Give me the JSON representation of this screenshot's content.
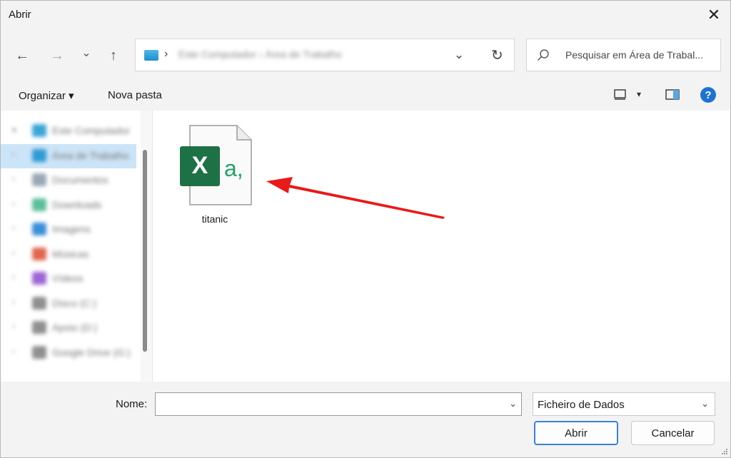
{
  "window": {
    "title": "Abrir",
    "close_glyph": "✕"
  },
  "nav": {
    "back_glyph": "←",
    "forward_glyph": "→",
    "recent_glyph": "⌄",
    "up_glyph": "↑",
    "address": {
      "separator": "›",
      "path": "Este Computador  ›  Área de Trabalho",
      "dropdown_glyph": "⌄",
      "refresh_glyph": "↻"
    },
    "search_placeholder": "Pesquisar em Área de Trabal..."
  },
  "toolbar": {
    "organize_label": "Organizar ▾",
    "new_folder_label": "Nova pasta",
    "view_dropdown_glyph": "▾",
    "help_glyph": "?"
  },
  "sidebar": {
    "items": [
      {
        "label": "Este Computador",
        "arrow": "▾",
        "color": "#3aa6d8"
      },
      {
        "label": "Área de Trabalho",
        "arrow": "›",
        "color": "#2e9ad6"
      },
      {
        "label": "Documentos",
        "arrow": "›",
        "color": "#9aa7b4"
      },
      {
        "label": "Downloads",
        "arrow": "›",
        "color": "#5bbf9a"
      },
      {
        "label": "Imagens",
        "arrow": "›",
        "color": "#3b8fd8"
      },
      {
        "label": "Músicas",
        "arrow": "›",
        "color": "#e0664f"
      },
      {
        "label": "Vídeos",
        "arrow": "›",
        "color": "#9b66d6"
      },
      {
        "label": "Disco (C:)",
        "arrow": "›",
        "color": "#8f8f8f"
      },
      {
        "label": "Apoio (D:)",
        "arrow": "›",
        "color": "#8f8f8f"
      },
      {
        "label": "Google Drive (G:)",
        "arrow": "›",
        "color": "#8f8f8f"
      }
    ]
  },
  "files": [
    {
      "name": "titanic",
      "icon": "excel-csv-icon",
      "letter": "X",
      "suffix": "a,"
    }
  ],
  "annotation": {
    "arrow_color": "#e81a1a"
  },
  "bottom": {
    "name_label": "Nome:",
    "name_value": "",
    "name_dropdown_glyph": "⌄",
    "filter_value": "Ficheiro de Dados",
    "filter_dropdown_glyph": "⌄",
    "open_label": "Abrir",
    "cancel_label": "Cancelar"
  }
}
